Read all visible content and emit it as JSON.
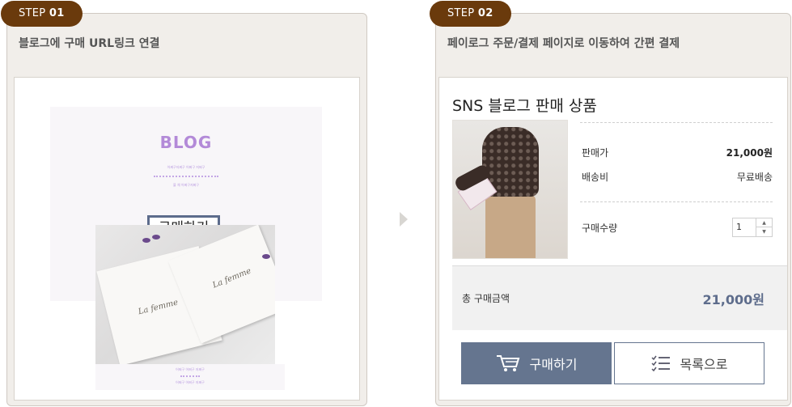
{
  "step1": {
    "badge_prefix": "STEP",
    "badge_number": "01",
    "heading": "블로그에 구매 URL링크 연결",
    "blog": {
      "title": "BLOG",
      "small_text_top": "어쩌구저쩌구 어쩌구 저쩌구",
      "small_text_mid": "블 체 어쩌구저쩌구",
      "buy_button": "구매하기",
      "card_text": "La femme",
      "small_text_bottom": "어쩌구 어쩌구 저쩌구"
    }
  },
  "step2": {
    "badge_prefix": "STEP",
    "badge_number": "02",
    "heading": "페이로그 주문/결제 페이지로 이동하여 간편 결제",
    "product_title": "SNS 블로그 판매 상품",
    "price_label": "판매가",
    "price_value": "21,000원",
    "shipping_label": "배송비",
    "shipping_value": "무료배송",
    "qty_label": "구매수량",
    "qty_value": "1",
    "total_label": "총 구매금액",
    "total_value": "21,000원",
    "buy_button": "구매하기",
    "list_button": "목록으로"
  },
  "colors": {
    "badge": "#6a3a0c",
    "accent": "#65758f",
    "blog_title": "#b38ad8"
  }
}
